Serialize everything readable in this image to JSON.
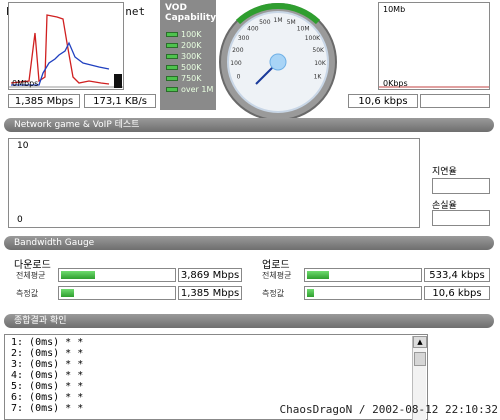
{
  "watermark": "http://www.bcpark.net",
  "throughput": {
    "axis_low": "0Mbps",
    "mbps": "1,385 Mbps",
    "kbs": "173,1 KB/s"
  },
  "vod": {
    "title": "VOD Capability",
    "levels": [
      "100K",
      "200K",
      "300K",
      "500K",
      "750K",
      "over 1M"
    ]
  },
  "gauge": {
    "ticks": [
      "0",
      "100",
      "200",
      "300",
      "400",
      "500",
      "1M",
      "5M",
      "10M",
      "100K",
      "50K",
      "10K",
      "1K"
    ]
  },
  "upload_graph": {
    "axis_top": "10Mb",
    "axis_low": "0Kbps",
    "value": "10,6 kbps"
  },
  "network_game": {
    "title": "Network game & VoIP 테스트",
    "y_top": "10",
    "y_bottom": "0",
    "latency_label": "지연율",
    "loss_label": "손실율"
  },
  "bandwidth": {
    "title": "Bandwidth Gauge",
    "download": {
      "title": "다운로드",
      "avg_label": "전체평균",
      "measured_label": "측정값",
      "avg_value": "3,869 Mbps",
      "measured_value": "1,385 Mbps",
      "avg_fill": 0.3,
      "measured_fill": 0.12
    },
    "upload": {
      "title": "업로드",
      "avg_label": "전체평균",
      "measured_label": "측정값",
      "avg_value": "533,4 kbps",
      "measured_value": "10,6 kbps",
      "avg_fill": 0.2,
      "measured_fill": 0.06
    }
  },
  "results": {
    "title": "종합결과 확인",
    "lines": [
      "1: (0ms) * *",
      "2: (0ms) * *",
      "3: (0ms) * *",
      "4: (0ms) * *",
      "5: (0ms) * *",
      "6: (0ms) * *",
      "7: (0ms) * *"
    ]
  },
  "signature": "ChaosDragoN / 2002-08-12 22:10:32"
}
